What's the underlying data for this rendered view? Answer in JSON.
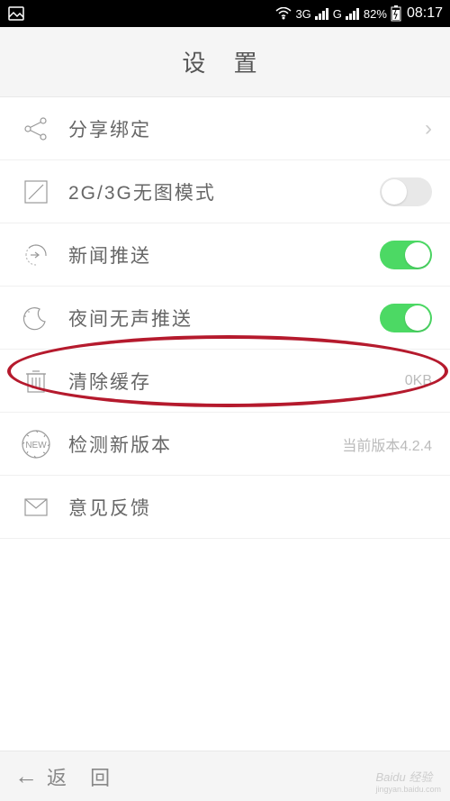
{
  "status": {
    "network1": "3G",
    "network2": "G",
    "battery": "82%",
    "time": "08:17"
  },
  "header": {
    "title": "设 置"
  },
  "rows": {
    "share": {
      "label": "分享绑定"
    },
    "noimage": {
      "label": "2G/3G无图模式",
      "state": "off"
    },
    "news": {
      "label": "新闻推送",
      "state": "on"
    },
    "night": {
      "label": "夜间无声推送",
      "state": "on"
    },
    "cache": {
      "label": "清除缓存",
      "value": "0KB"
    },
    "update": {
      "label": "检测新版本",
      "value": "当前版本4.2.4"
    },
    "feedback": {
      "label": "意见反馈"
    }
  },
  "footer": {
    "back": "返 回"
  },
  "watermark": {
    "line1": "Baidu 经验",
    "line2": "jingyan.baidu.com"
  }
}
